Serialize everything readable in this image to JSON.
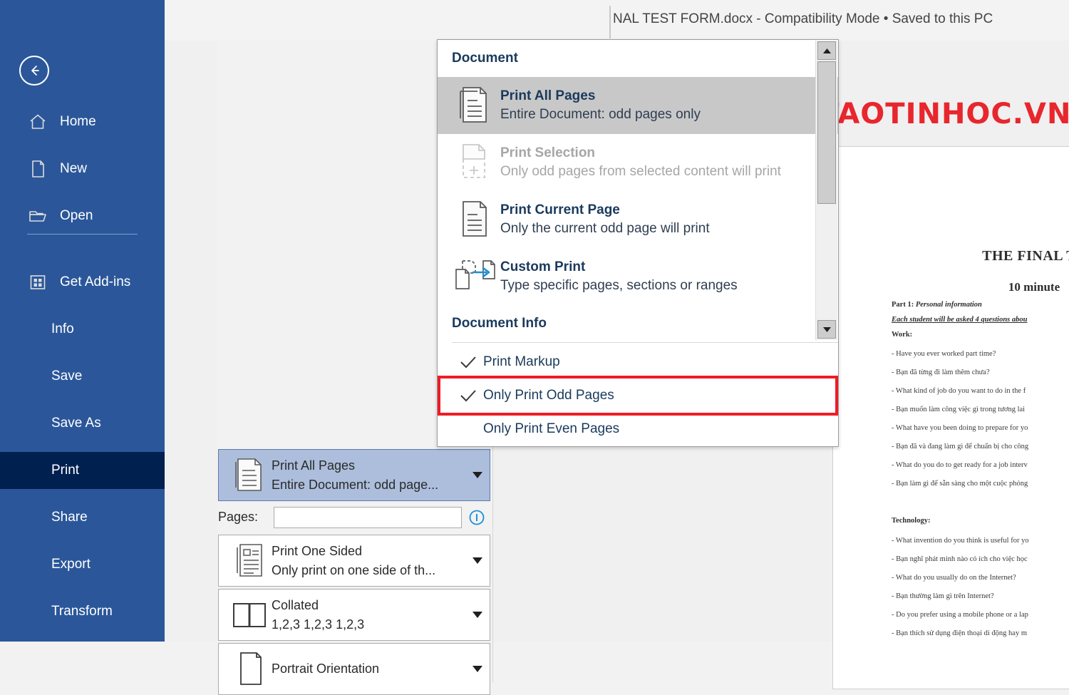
{
  "app": {
    "accent_blue": "#2B579A",
    "active_blue": "#002050",
    "highlight_red": "#EE1C25"
  },
  "titlebar": {
    "text": "NAL TEST FORM.docx  -  Compatibility Mode • Saved to this PC"
  },
  "watermark": {
    "text": "DAOTAOTINHOC.VN",
    "color": "#E8262D",
    "mark": "v-logo-icon"
  },
  "sidebar": {
    "back_label": "back-arrow-icon",
    "items": [
      {
        "label": "Home",
        "icon": "home-icon",
        "active": false,
        "has_icon": true
      },
      {
        "label": "New",
        "icon": "page-icon",
        "active": false,
        "has_icon": true
      },
      {
        "label": "Open",
        "icon": "folder-icon",
        "active": false,
        "has_icon": true
      },
      {
        "label": "Get Add-ins",
        "icon": "grid-icon",
        "active": false,
        "has_icon": true
      },
      {
        "label": "Info",
        "icon": "",
        "active": false,
        "has_icon": false
      },
      {
        "label": "Save",
        "icon": "",
        "active": false,
        "has_icon": false
      },
      {
        "label": "Save As",
        "icon": "",
        "active": false,
        "has_icon": false
      },
      {
        "label": "Print",
        "icon": "",
        "active": true,
        "has_icon": false
      },
      {
        "label": "Share",
        "icon": "",
        "active": false,
        "has_icon": false
      },
      {
        "label": "Export",
        "icon": "",
        "active": false,
        "has_icon": false
      },
      {
        "label": "Transform",
        "icon": "",
        "active": false,
        "has_icon": false
      }
    ]
  },
  "dropdown": {
    "section_document": "Document",
    "section_document_info": "Document Info",
    "items": [
      {
        "title": "Print All Pages",
        "subtitle": "Entire Document: odd pages only",
        "icon": "print-all-pages-icon",
        "state": "highlighted"
      },
      {
        "title": "Print Selection",
        "subtitle": "Only odd pages from selected content will print",
        "icon": "print-selection-icon",
        "state": "disabled"
      },
      {
        "title": "Print Current Page",
        "subtitle": "Only the current odd page will print",
        "icon": "print-current-page-icon",
        "state": "normal"
      },
      {
        "title": "Custom Print",
        "subtitle": "Type specific pages, sections or ranges",
        "icon": "custom-print-icon",
        "state": "normal"
      }
    ],
    "checks": [
      {
        "label": "Print Markup",
        "checked": true,
        "boxed": false
      },
      {
        "label": "Only Print Odd Pages",
        "checked": true,
        "boxed": true
      },
      {
        "label": "Only Print Even Pages",
        "checked": false,
        "boxed": false
      }
    ],
    "scroll_up": "scroll-up-icon",
    "scroll_down": "scroll-down-icon"
  },
  "settings": {
    "print_range": {
      "title": "Print All Pages",
      "subtitle": "Entire Document: odd page...",
      "icon": "print-all-pages-icon"
    },
    "pages": {
      "label": "Pages:",
      "value": "",
      "placeholder": "",
      "info_icon": "info-icon"
    },
    "sided": {
      "title": "Print One Sided",
      "subtitle": "Only print on one side of th...",
      "icon": "one-sided-icon"
    },
    "collation": {
      "title": "Collated",
      "subtitle": "1,2,3   1,2,3   1,2,3",
      "icon": "collate-icon"
    },
    "orientation": {
      "title": "Portrait Orientation",
      "subtitle": "",
      "icon": "portrait-icon"
    }
  },
  "document_preview": {
    "title": "THE FINAL TE",
    "subtitle": "10 minute",
    "part_label": "Part 1:",
    "part_title": "Personal information",
    "instruction": "Each student will be asked 4 questions abou",
    "section_work": "Work:",
    "work_lines": [
      "- Have you ever worked part time?",
      " - Bạn đã từng đi làm thêm chưa?",
      "- What kind of job do you want to do in the f",
      " - Bạn muốn làm công việc gì trong tương lai",
      "- What have you been doing to prepare for yo",
      "- Bạn đã và đang làm gì để chuẩn bị cho công",
      "- What do you do to get ready for a job interv",
      "- Bạn làm gì để sẵn sàng cho một cuộc phỏng"
    ],
    "section_technology": "Technology:",
    "technology_lines": [
      "- What invention do you think is useful for yo",
      "- Bạn nghĩ phát minh nào có ích cho việc học",
      "- What do you usually do on the Internet?",
      "- Bạn thường làm gì trên Internet?",
      "- Do you prefer using a mobile phone or a lap",
      "- Bạn thích sử dụng điện thoại di động hay m"
    ]
  }
}
